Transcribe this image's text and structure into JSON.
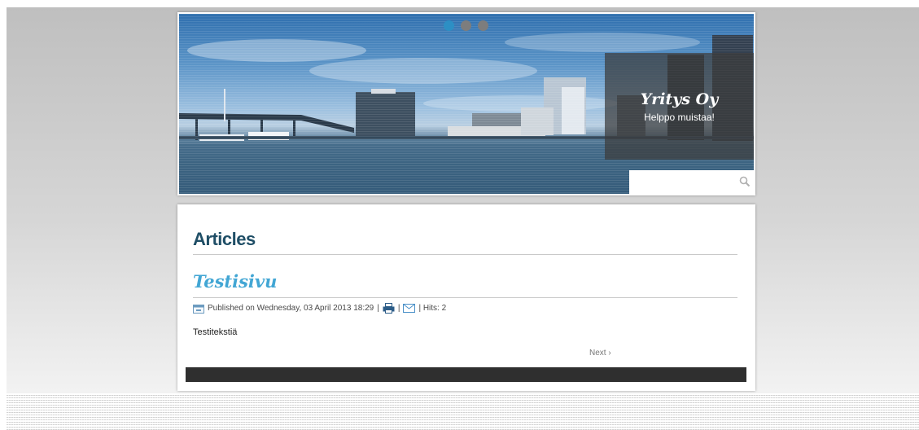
{
  "header": {
    "site_name": "Yritys Oy",
    "tagline": "Helppo muistaa!",
    "slider_dots": [
      true,
      false,
      false
    ],
    "search": {
      "value": "",
      "placeholder": ""
    },
    "accent": "#2d8fc4"
  },
  "content": {
    "section_title": "Articles",
    "article": {
      "title": "Testisivu",
      "published": "Published on Wednesday, 03 April 2013 18:29",
      "sep1": "|",
      "sep2": "|",
      "hits": "| Hits: 2",
      "body": "Testitekstiä"
    },
    "next_label": "Next ›"
  },
  "colors": {
    "title": "#1f4e66",
    "article_title": "#42a6d4",
    "footer_bar": "#2f2f2f"
  }
}
